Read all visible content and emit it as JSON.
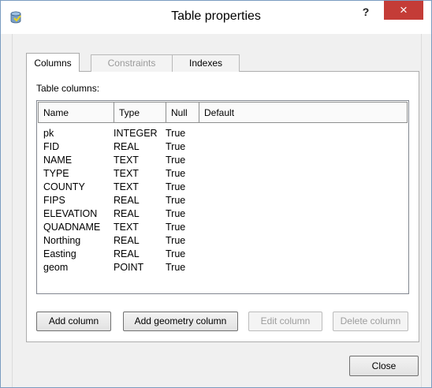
{
  "window": {
    "title": "Table properties",
    "help": "?",
    "close_glyph": "×"
  },
  "tabs": [
    {
      "label": "Columns",
      "state": "active"
    },
    {
      "label": "Constraints",
      "state": "disabled"
    },
    {
      "label": "Indexes",
      "state": "normal"
    }
  ],
  "section_label": "Table columns:",
  "table": {
    "headers": [
      "Name",
      "Type",
      "Null",
      "Default"
    ],
    "rows": [
      [
        "pk",
        "INTEGER",
        "True",
        ""
      ],
      [
        "FID",
        "REAL",
        "True",
        ""
      ],
      [
        "NAME",
        "TEXT",
        "True",
        ""
      ],
      [
        "TYPE",
        "TEXT",
        "True",
        ""
      ],
      [
        "COUNTY",
        "TEXT",
        "True",
        ""
      ],
      [
        "FIPS",
        "REAL",
        "True",
        ""
      ],
      [
        "ELEVATION",
        "REAL",
        "True",
        ""
      ],
      [
        "QUADNAME",
        "TEXT",
        "True",
        ""
      ],
      [
        "Northing",
        "REAL",
        "True",
        ""
      ],
      [
        "Easting",
        "REAL",
        "True",
        ""
      ],
      [
        "geom",
        "POINT",
        "True",
        ""
      ]
    ]
  },
  "buttons": {
    "add_column": "Add column",
    "add_geometry_column": "Add geometry column",
    "edit_column": "Edit column",
    "delete_column": "Delete column",
    "close": "Close"
  },
  "colors": {
    "close_button": "#c43c37",
    "window_border": "#7a9cc0"
  }
}
